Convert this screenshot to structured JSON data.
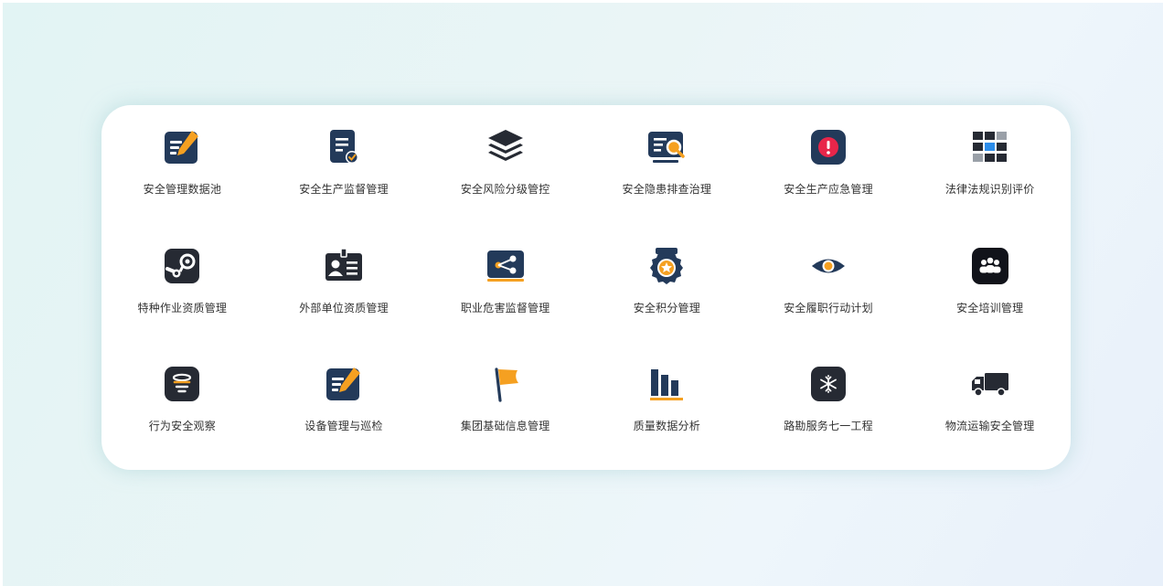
{
  "colors": {
    "navy": "#233a5a",
    "dark": "#262a33",
    "orange": "#f5a021",
    "red": "#e8264a",
    "blue": "#2c8dea"
  },
  "modules": [
    {
      "label": "安全管理数据池",
      "icon": "edit-square-icon"
    },
    {
      "label": "安全生产监督管理",
      "icon": "document-check-icon"
    },
    {
      "label": "安全风险分级管控",
      "icon": "layers-icon"
    },
    {
      "label": "安全隐患排查治理",
      "icon": "screen-search-icon"
    },
    {
      "label": "安全生产应急管理",
      "icon": "alert-icon"
    },
    {
      "label": "法律法规识别评价",
      "icon": "grid-icon"
    },
    {
      "label": "特种作业资质管理",
      "icon": "steam-icon"
    },
    {
      "label": "外部单位资质管理",
      "icon": "id-badge-icon"
    },
    {
      "label": "职业危害监督管理",
      "icon": "share-board-icon"
    },
    {
      "label": "安全积分管理",
      "icon": "medal-icon"
    },
    {
      "label": "安全履职行动计划",
      "icon": "eye-icon"
    },
    {
      "label": "安全培训管理",
      "icon": "group-icon"
    },
    {
      "label": "行为安全观察",
      "icon": "tornado-icon"
    },
    {
      "label": "设备管理与巡检",
      "icon": "edit-square-icon"
    },
    {
      "label": "集团基础信息管理",
      "icon": "flag-icon"
    },
    {
      "label": "质量数据分析",
      "icon": "bar-chart-icon"
    },
    {
      "label": "路勘服务七一工程",
      "icon": "snowflake-icon"
    },
    {
      "label": "物流运输安全管理",
      "icon": "truck-icon"
    }
  ]
}
